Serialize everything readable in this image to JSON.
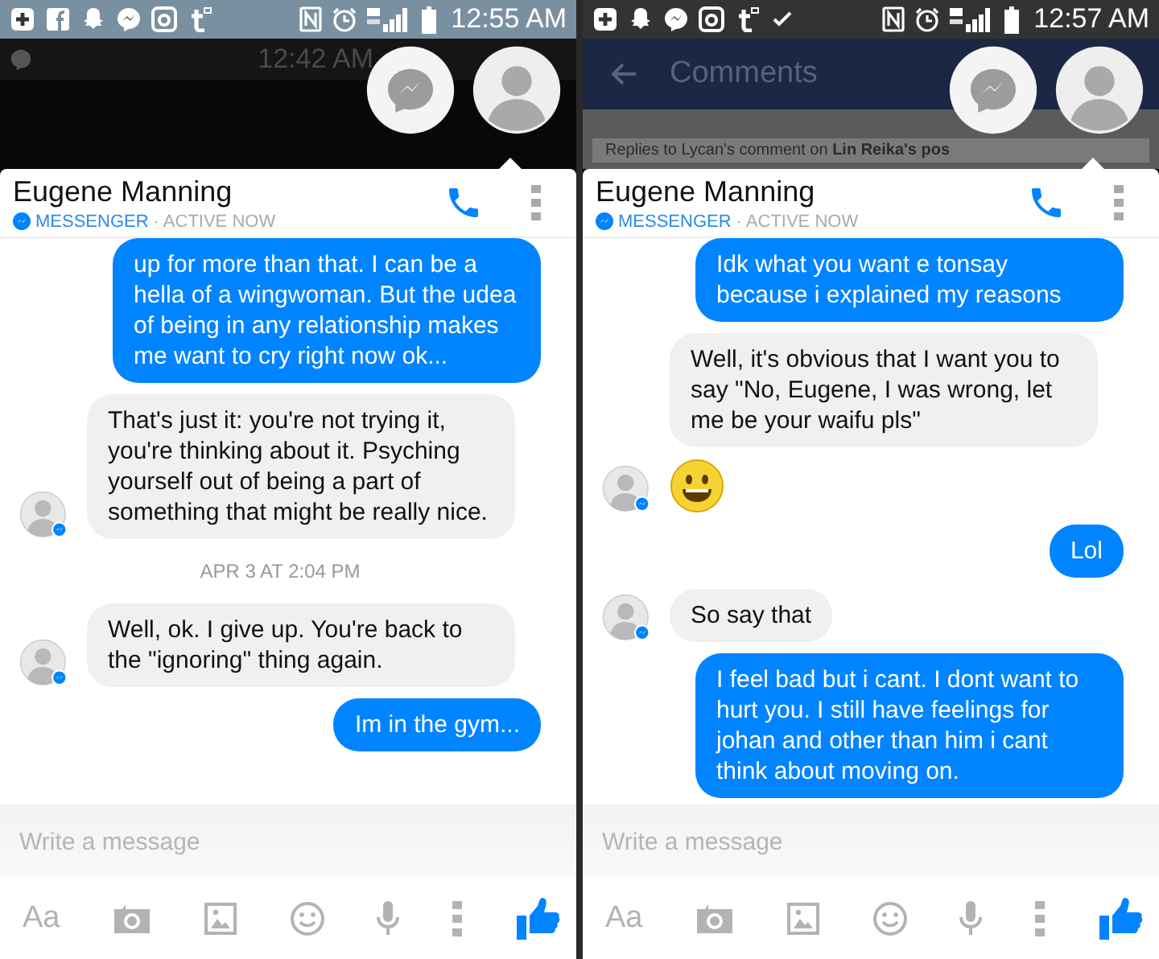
{
  "phones": [
    {
      "status_bar": {
        "time": "12:55 AM"
      },
      "background": {
        "kind": "home",
        "time": "12:42 AM"
      },
      "chat": {
        "name": "Eugene Manning",
        "source": "MESSENGER",
        "presence": "· ACTIVE NOW"
      },
      "messages": [
        {
          "kind": "sent",
          "text": "up for more than that. I can be a hella of a wingwoman. But the udea of being in any relationship makes me want to cry right now ok..."
        },
        {
          "kind": "received",
          "avatar": true,
          "text": "That's just it: you're not trying it, you're thinking about it. Psyching yourself out of being a part of something that might be really nice."
        },
        {
          "kind": "time",
          "text": "APR 3 AT 2:04 PM"
        },
        {
          "kind": "received",
          "avatar": true,
          "text": "Well, ok. I give up. You're back to the \"ignoring\" thing again."
        },
        {
          "kind": "sent",
          "text": "Im in the gym..."
        }
      ],
      "composer": {
        "placeholder": "Write a message",
        "text_button": "Aa"
      }
    },
    {
      "status_bar": {
        "time": "12:57 AM"
      },
      "background": {
        "kind": "comments",
        "title": "Comments",
        "notice": "Replies to Lycan's comment on **Lin Reika's pos**"
      },
      "chat": {
        "name": "Eugene Manning",
        "source": "MESSENGER",
        "presence": "· ACTIVE NOW"
      },
      "messages": [
        {
          "kind": "sent",
          "text": "Idk what you want e tonsay because i explained my reasons"
        },
        {
          "kind": "received",
          "avatar": false,
          "text": "Well, it's obvious that I want you to say \"No, Eugene, I was wrong, let me be your waifu pls\""
        },
        {
          "kind": "emoji",
          "avatar": true
        },
        {
          "kind": "sent",
          "text": "Lol"
        },
        {
          "kind": "received",
          "avatar": true,
          "text": "So say that"
        },
        {
          "kind": "sent",
          "text": "I feel bad but i cant. I dont want to hurt you. I still have feelings for johan and other than him i cant think about moving on."
        }
      ],
      "composer": {
        "placeholder": "Write a message",
        "text_button": "Aa"
      }
    }
  ]
}
